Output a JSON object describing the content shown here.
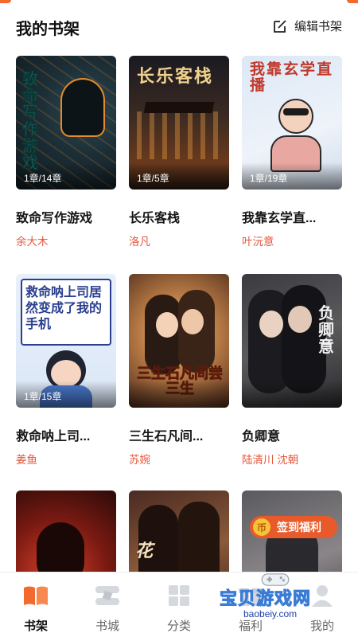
{
  "header": {
    "title": "我的书架",
    "edit_label": "编辑书架"
  },
  "books": [
    {
      "title": "致命写作游戏",
      "author": "余大木",
      "progress": "1章/14章",
      "cover_title": "致命写作游戏"
    },
    {
      "title": "长乐客栈",
      "author": "洛凡",
      "progress": "1章/5章",
      "cover_title": "长乐客栈"
    },
    {
      "title": "我靠玄学直...",
      "author": "叶沅意",
      "progress": "1章/19章",
      "cover_title": "我靠玄学直播"
    },
    {
      "title": "救命呐上司...",
      "author": "姜鱼",
      "progress": "1章/15章",
      "cover_title": "救命呐上司居然变成了我的手机"
    },
    {
      "title": "三生石凡间...",
      "author": "苏婉",
      "progress": "",
      "cover_title": "三生石凡间尝三生"
    },
    {
      "title": "负卿意",
      "author": "陆清川 沈朝",
      "progress": "",
      "cover_title": "负卿意"
    },
    {
      "title": "",
      "author": "",
      "progress": "",
      "cover_title": ""
    },
    {
      "title": "",
      "author": "",
      "progress": "",
      "cover_title": "花"
    },
    {
      "title": "",
      "author": "",
      "progress": "",
      "cover_title": ""
    }
  ],
  "checkin": {
    "coin_label": "币",
    "label": "签到福利"
  },
  "tabs": [
    {
      "label": "书架",
      "icon": "book-icon",
      "active": true
    },
    {
      "label": "书城",
      "icon": "bookstore-icon",
      "active": false
    },
    {
      "label": "分类",
      "icon": "category-grid-icon",
      "active": false
    },
    {
      "label": "福利",
      "icon": "gift-icon",
      "active": false
    },
    {
      "label": "我的",
      "icon": "profile-icon",
      "active": false
    }
  ],
  "watermark": {
    "main": "宝贝游戏网",
    "sub": "baobeiy.com"
  },
  "colors": {
    "accent": "#f26a2e",
    "author_text": "#e4573d",
    "checkin_bg": "#e85a2a"
  }
}
